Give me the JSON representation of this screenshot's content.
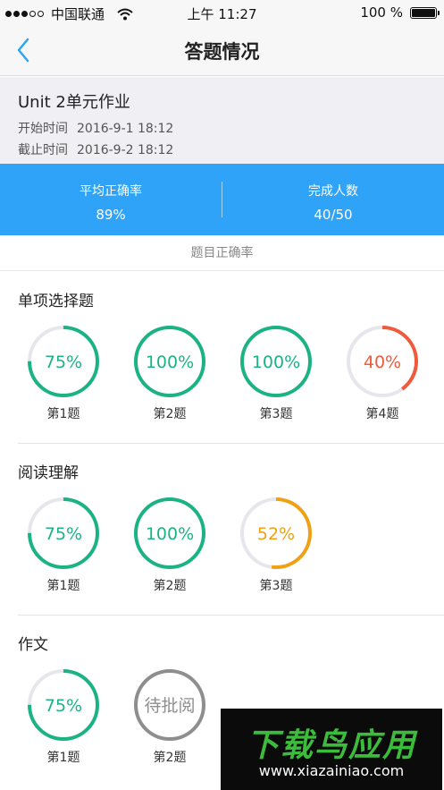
{
  "status_bar": {
    "carrier": "中国联通",
    "time": "上午 11:27",
    "battery": "100 %"
  },
  "nav": {
    "title": "答题情况"
  },
  "assignment": {
    "title": "Unit 2单元作业",
    "start_label": "开始时间",
    "start_value": "2016-9-1 18:12",
    "end_label": "截止时间",
    "end_value": "2016-9-2 18:12"
  },
  "stats": {
    "avg_label": "平均正确率",
    "avg_value": "89%",
    "done_label": "完成人数",
    "done_value": "40/50"
  },
  "caption": "题目正确率",
  "colors": {
    "green": "#1bb384",
    "orange_red": "#f05a3c",
    "orange": "#f0a012",
    "gray": "#8e8e8e",
    "track": "#e6e7ec",
    "blue": "#2fa3f7"
  },
  "groups": [
    {
      "title": "单项选择题",
      "questions": [
        {
          "label": "第1题",
          "text": "75%",
          "percent": 75,
          "color": "#1bb384"
        },
        {
          "label": "第2题",
          "text": "100%",
          "percent": 100,
          "color": "#1bb384"
        },
        {
          "label": "第3题",
          "text": "100%",
          "percent": 100,
          "color": "#1bb384"
        },
        {
          "label": "第4题",
          "text": "40%",
          "percent": 40,
          "color": "#f05a3c"
        }
      ]
    },
    {
      "title": "阅读理解",
      "questions": [
        {
          "label": "第1题",
          "text": "75%",
          "percent": 75,
          "color": "#1bb384"
        },
        {
          "label": "第2题",
          "text": "100%",
          "percent": 100,
          "color": "#1bb384"
        },
        {
          "label": "第3题",
          "text": "52%",
          "percent": 52,
          "color": "#f0a012"
        }
      ]
    },
    {
      "title": "作文",
      "questions": [
        {
          "label": "第1题",
          "text": "75%",
          "percent": 75,
          "color": "#1bb384"
        },
        {
          "label": "第2题",
          "text": "待批阅",
          "percent": 100,
          "color": "#8e8e8e"
        }
      ]
    }
  ],
  "watermark": {
    "brand": "下载鸟应用",
    "url": "www.xiazainiao.com"
  }
}
